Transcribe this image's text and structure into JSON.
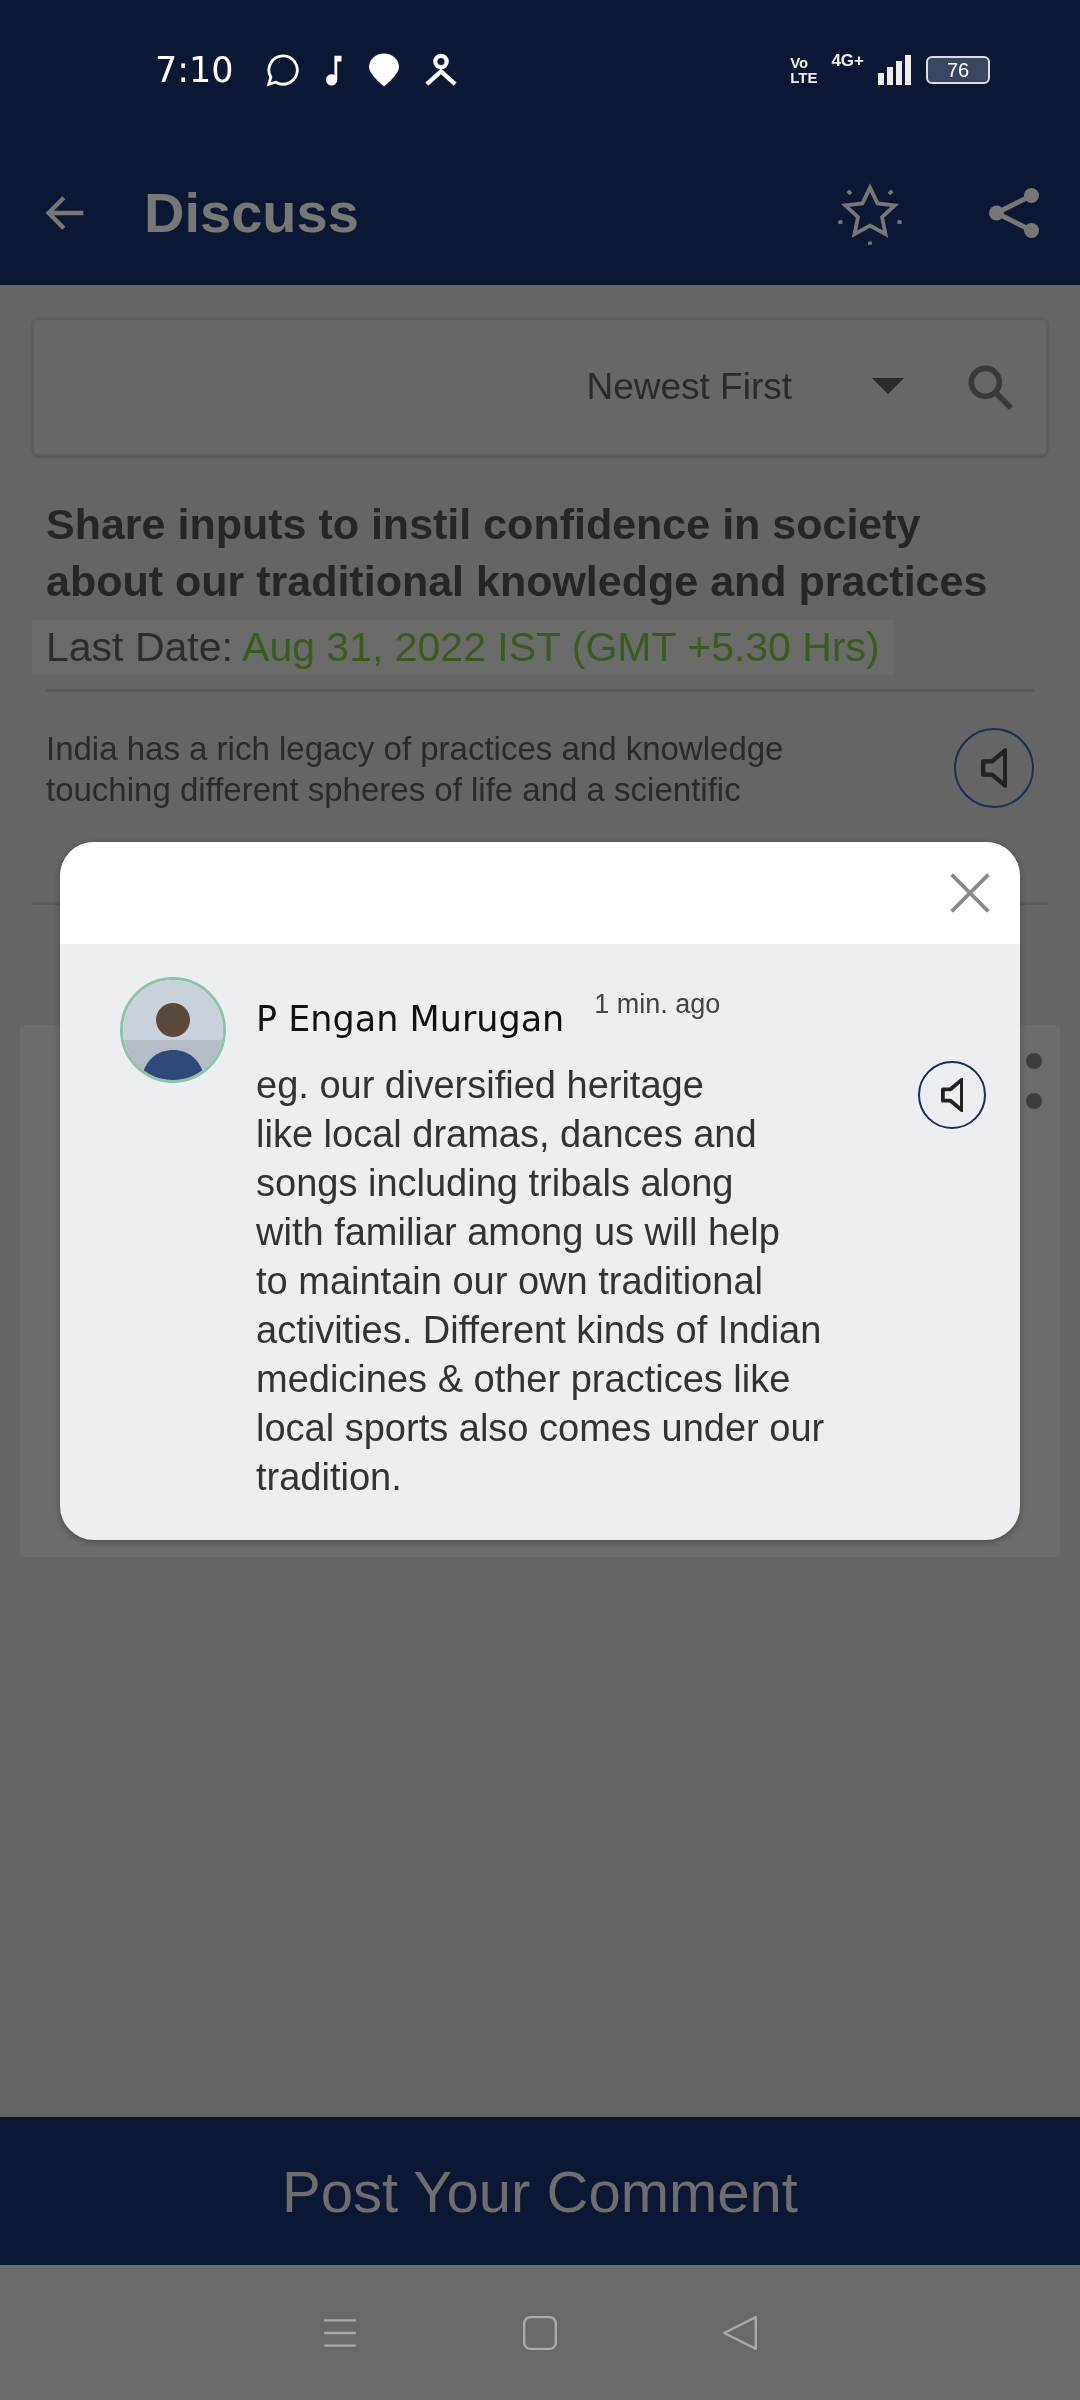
{
  "status_bar": {
    "time": "7:10",
    "volte": [
      "Vo",
      "LTE"
    ],
    "network": "4G+",
    "battery": "76"
  },
  "app_bar": {
    "title": "Discuss"
  },
  "filter": {
    "sort": "Newest First"
  },
  "topic": {
    "title": "Share inputs to instil confidence in society about our traditional knowledge and practices",
    "last_date_label": "Last Date:",
    "last_date": "Aug 31, 2022 IST (GMT +5.30 Hrs)",
    "description": "India has a rich legacy of practices and knowledge touching different spheres of life and a scientific"
  },
  "dialog": {
    "comment": {
      "author": "P Engan Murugan",
      "time": "1 min. ago",
      "text": "eg. our diversified heritage\nlike local dramas, dances and\nsongs including tribals along\nwith familiar among us will help\nto maintain our own traditional\nactivities. Different kinds of Indian\nmedicines & other practices like\nlocal sports also comes under our\ntradition."
    }
  },
  "post_button": "Post Your Comment"
}
